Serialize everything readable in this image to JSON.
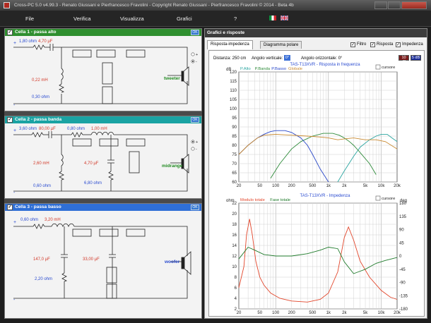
{
  "window": {
    "title": "Cross-PC 5.0 v4.99.3 - Renato Giussani e Pierfrancesco Fravolini - Copyright Renato Giussani - Pierfrancesco Fravolini © 2014 - Beta 4b"
  },
  "menu": [
    {
      "label": "File",
      "x": 36
    },
    {
      "label": "Verifica",
      "x": 104
    },
    {
      "label": "Visualizza",
      "x": 170
    },
    {
      "label": "Grafici",
      "x": 250
    },
    {
      "label": "?",
      "x": 331
    }
  ],
  "cells": [
    {
      "title": "Cella 1 - passa alto",
      "color": "#2f8f2f",
      "ok": "OK",
      "labels": {
        "series_r": "1,80 ohm",
        "series_c": "4,70 µF",
        "shunt_l": "0,22 mH",
        "shunt_r": "0,30 ohm",
        "driver": "tweeter"
      }
    },
    {
      "title": "Cella 2 - passa banda",
      "color": "#1aa3a3",
      "ok": "OK",
      "labels": {
        "series_r": "3,60 ohm",
        "series_c": "80,00 µF",
        "series_r2": "0,80 ohm",
        "series_l": "1,00 mH",
        "shunt_l": "2,60 mH",
        "shunt_r": "0,60 ohm",
        "shunt_c": "4,70 µF",
        "shunt_r2": "6,80 ohm",
        "driver": "midrange"
      }
    },
    {
      "title": "Cella 3 - passa basso",
      "color": "#2f6fd6",
      "ok": "OK",
      "labels": {
        "series_r": "0,60 ohm",
        "series_l": "3,20 mH",
        "shunt_c": "147,0 µF",
        "shunt_r": "2,20 ohm",
        "shunt_c2": "33,00 µF",
        "driver": "woofer"
      }
    }
  ],
  "right": {
    "header": "Grafici e risposte",
    "tabs": [
      "Risposta-impedenza",
      "Diagramma polare"
    ],
    "checks": [
      {
        "label": "Filtro",
        "checked": true
      },
      {
        "label": "Risposta",
        "checked": true
      },
      {
        "label": "Impedenza",
        "checked": true
      }
    ],
    "distance": "Distanza: 250 cm",
    "vert_label": "Angolo verticale:",
    "vert_value": "0°",
    "horiz_label": "Angolo orizzontale: 0°",
    "db_buttons": [
      "10 dB",
      "5 dB"
    ],
    "cursore": "cursore"
  },
  "colors": {
    "alto": "#2aa5a0",
    "banda": "#2e8b3a",
    "basso": "#2846c8",
    "globale": "#c98a30",
    "imped": "#e2452a",
    "fase": "#1e7a2a"
  },
  "chart_data": [
    {
      "type": "line",
      "title": "TAS-T13XVR - Risposta in frequenza",
      "legend": [
        "P.Alto",
        "P.Banda",
        "P.Basso",
        "Globale"
      ],
      "ylabel": "dB",
      "xscale": "log",
      "xlim": [
        20,
        20000
      ],
      "ylim": [
        60,
        120
      ],
      "yticks": [
        60,
        65,
        70,
        75,
        80,
        85,
        90,
        95,
        100,
        105,
        110,
        115,
        120
      ],
      "xticks": [
        "20",
        "50",
        "100",
        "200",
        "500",
        "1k",
        "2k",
        "5k",
        "10k",
        "20k"
      ],
      "grid": true,
      "series": [
        {
          "name": "P.Alto",
          "x": [
            1500,
            2000,
            3000,
            4000,
            6000,
            8000,
            10000,
            13000,
            16000,
            20000
          ],
          "y": [
            60,
            66,
            74,
            79,
            83,
            85,
            86,
            86,
            84,
            82
          ]
        },
        {
          "name": "P.Banda",
          "x": [
            80,
            120,
            200,
            300,
            500,
            800,
            1200,
            1600,
            2000,
            2500,
            3000,
            4000,
            6000,
            8000
          ],
          "y": [
            62,
            70,
            78,
            82,
            85,
            86.5,
            86.5,
            85.5,
            84,
            82,
            80,
            76,
            70,
            64
          ]
        },
        {
          "name": "P.Basso",
          "x": [
            20,
            30,
            45,
            60,
            80,
            100,
            150,
            200,
            300,
            400,
            500,
            700,
            1000
          ],
          "y": [
            75,
            80,
            84,
            86,
            87.5,
            88,
            88,
            87,
            84,
            80,
            75,
            67,
            60
          ]
        },
        {
          "name": "Globale",
          "x": [
            20,
            30,
            45,
            60,
            100,
            200,
            400,
            700,
            1000,
            1500,
            2000,
            3000,
            5000,
            8000,
            12000,
            20000
          ],
          "y": [
            75,
            80,
            84,
            85.5,
            86,
            85.5,
            85,
            84.5,
            84,
            83,
            83.5,
            84,
            83,
            83,
            82,
            78
          ]
        }
      ]
    },
    {
      "type": "line",
      "title": "TAS-T13XVR - Impedenza",
      "legend": [
        "Modulo totale",
        "Fase totale"
      ],
      "ylabel": "ohm",
      "ylabel_right": "deg",
      "xscale": "log",
      "xlim": [
        20,
        20000
      ],
      "ylim": [
        2,
        22
      ],
      "ylim_right": [
        -180,
        180
      ],
      "yticks": [
        2,
        4,
        6,
        8,
        10,
        12,
        14,
        16,
        18,
        20,
        22
      ],
      "yticks_right": [
        -180,
        -135,
        -90,
        -45,
        0,
        45,
        90,
        135,
        180
      ],
      "xticks": [
        "20",
        "50",
        "100",
        "200",
        "500",
        "1k",
        "2k",
        "5k",
        "10k",
        "20k"
      ],
      "grid": true,
      "series": [
        {
          "name": "Modulo totale",
          "x": [
            20,
            25,
            28,
            32,
            36,
            42,
            50,
            60,
            80,
            120,
            200,
            400,
            700,
            1000,
            1500,
            2000,
            2400,
            3000,
            4000,
            6000,
            10000,
            15000,
            20000
          ],
          "y": [
            6,
            10,
            16,
            19,
            16,
            11,
            8,
            6.5,
            5,
            4,
            3.5,
            3.3,
            3.8,
            5,
            9,
            15.5,
            17.5,
            15,
            11,
            8,
            5.5,
            4.2,
            3.8
          ]
        },
        {
          "name": "Fase totale",
          "x": [
            20,
            30,
            40,
            60,
            100,
            200,
            400,
            700,
            1000,
            1500,
            2000,
            3000,
            5000,
            8000,
            12000,
            20000
          ],
          "y": [
            -10,
            30,
            20,
            5,
            0,
            0,
            8,
            20,
            30,
            25,
            -20,
            -60,
            -45,
            -25,
            -15,
            -5
          ]
        }
      ]
    }
  ]
}
